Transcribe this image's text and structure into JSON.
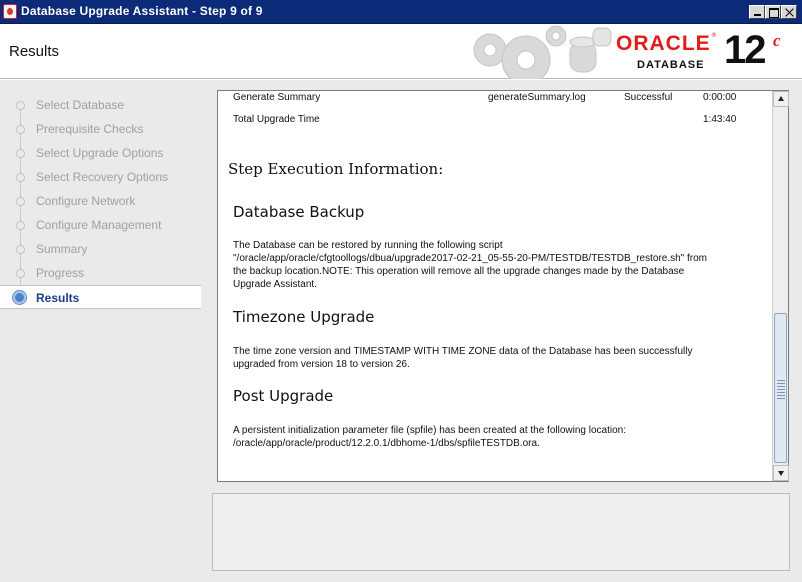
{
  "window": {
    "title": "Database Upgrade Assistant - Step 9 of 9"
  },
  "header": {
    "title": "Results",
    "brand": "ORACLE",
    "brand_mark": "®",
    "product": "DATABASE",
    "version": "12",
    "version_suffix": "c"
  },
  "sidebar": {
    "steps": [
      {
        "label": "Select Database"
      },
      {
        "label": "Prerequisite Checks"
      },
      {
        "label": "Select Upgrade Options"
      },
      {
        "label": "Select Recovery Options"
      },
      {
        "label": "Configure Network"
      },
      {
        "label": "Configure Management"
      },
      {
        "label": "Summary"
      },
      {
        "label": "Progress"
      },
      {
        "label": "Results"
      }
    ],
    "active_index": 8
  },
  "results": {
    "rows": [
      {
        "name": "Generate Summary",
        "log": "generateSummary.log",
        "status": "Successful",
        "time": "0:00:00"
      },
      {
        "name": "Total Upgrade Time",
        "log": "",
        "status": "",
        "time": "1:43:40"
      }
    ],
    "step_execution_heading": "Step Execution Information:",
    "sections": [
      {
        "heading": "Database Backup",
        "lines": [
          "The Database can be restored by running the following script",
          "\"/oracle/app/oracle/cfgtoollogs/dbua/upgrade2017-02-21_05-55-20-PM/TESTDB/TESTDB_restore.sh\" from",
          "the backup location.NOTE: This operation will remove all the upgrade changes made by the Database",
          "Upgrade Assistant."
        ]
      },
      {
        "heading": "Timezone Upgrade",
        "lines": [
          "The time zone version and TIMESTAMP WITH TIME ZONE data of the Database has been successfully",
          "upgraded from version 18 to version 26."
        ]
      },
      {
        "heading": "Post Upgrade",
        "lines": [
          "A persistent initialization parameter file (spfile) has been created at the following location:",
          "/oracle/app/oracle/product/12.2.0.1/dbhome-1/dbs/spfileTESTDB.ora."
        ]
      }
    ]
  },
  "colors": {
    "titlebar": "#0b2a78",
    "brand_red": "#e21b1b",
    "active_step": "#1f3c88"
  }
}
